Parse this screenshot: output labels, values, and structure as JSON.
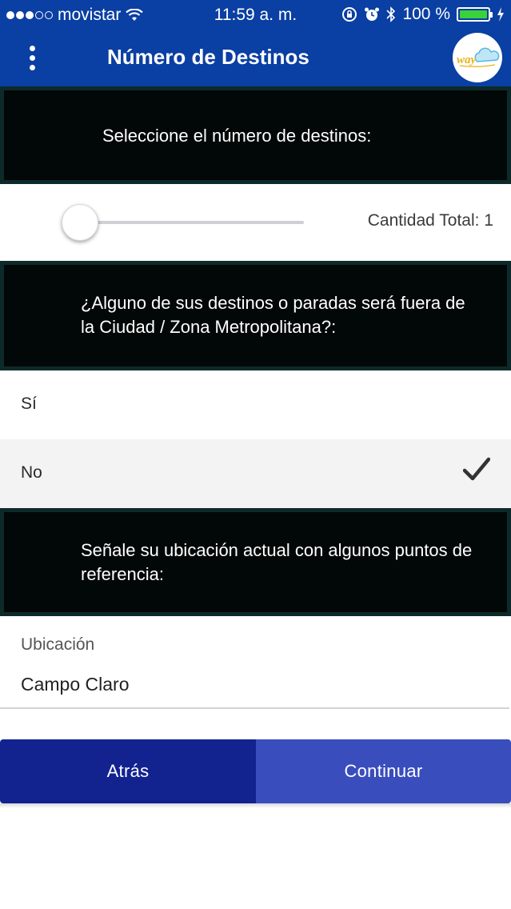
{
  "status_bar": {
    "carrier": "movistar",
    "time": "11:59 a. m.",
    "battery": "100 %"
  },
  "app_bar": {
    "title": "Número de Destinos",
    "logo_text": "way"
  },
  "destinations": {
    "prompt": "Seleccione el número de destinos:",
    "total_label": "Cantidad Total: 1",
    "slider_value": 1
  },
  "outside_city": {
    "prompt": "¿Alguno de sus destinos o paradas será fuera de la Ciudad / Zona Metropolitana?:",
    "options": [
      {
        "label": "Sí",
        "selected": false
      },
      {
        "label": "No",
        "selected": true
      }
    ]
  },
  "location": {
    "prompt": "Señale su ubicación actual con algunos puntos de referencia:",
    "field_label": "Ubicación",
    "field_value": "Campo Claro"
  },
  "actions": {
    "back_label": "Atrás",
    "continue_label": "Continuar"
  },
  "colors": {
    "primary": "#0a3fa3",
    "back_button": "#12228f",
    "continue_button": "#3a4dbd",
    "banner": "#020807",
    "battery": "#39d23a"
  }
}
